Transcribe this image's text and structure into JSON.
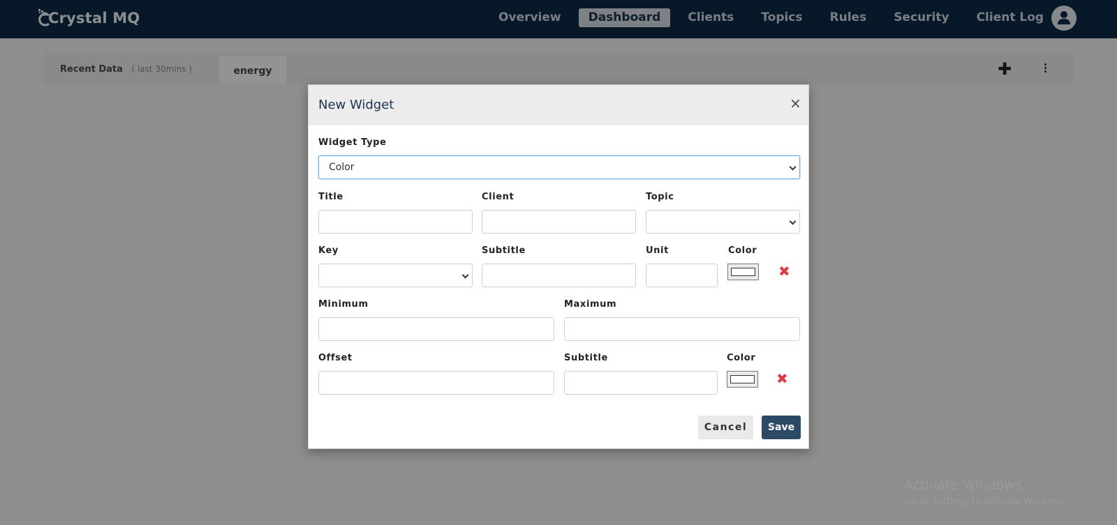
{
  "app": {
    "brand": "Crystal MQ"
  },
  "nav": {
    "items": [
      {
        "label": "Overview",
        "active": false
      },
      {
        "label": "Dashboard",
        "active": true
      },
      {
        "label": "Clients",
        "active": false
      },
      {
        "label": "Topics",
        "active": false
      },
      {
        "label": "Rules",
        "active": false
      },
      {
        "label": "Security",
        "active": false
      },
      {
        "label": "Client Log",
        "active": false
      }
    ],
    "avatar_icon": "user-icon"
  },
  "tabs": {
    "recent_label": "Recent Data",
    "recent_sub": "( last 30mins )",
    "active_tab": "energy",
    "add_icon": "plus-icon",
    "menu_icon": "kebab-menu-icon"
  },
  "modal": {
    "title": "New Widget",
    "close_icon": "close-icon",
    "widget_type": {
      "label": "Widget Type",
      "value": "Color"
    },
    "title_field": {
      "label": "Title",
      "value": ""
    },
    "client_field": {
      "label": "Client",
      "value": ""
    },
    "topic_field": {
      "label": "Topic",
      "value": ""
    },
    "key_field": {
      "label": "Key",
      "value": ""
    },
    "subtitle_field_1": {
      "label": "Subtitle",
      "value": ""
    },
    "unit_field": {
      "label": "Unit",
      "value": ""
    },
    "color_field_1": {
      "label": "Color",
      "value": "#ffffff"
    },
    "minimum_field": {
      "label": "Minimum",
      "value": ""
    },
    "maximum_field": {
      "label": "Maximum",
      "value": ""
    },
    "offset_field": {
      "label": "Offset",
      "value": ""
    },
    "subtitle_field_2": {
      "label": "Subtitle",
      "value": ""
    },
    "color_field_2": {
      "label": "Color",
      "value": "#ffffff"
    },
    "delete_icon": "x-mark-icon",
    "delete_color": "#e23a47",
    "cancel_label": "Cancel",
    "save_label": "Save"
  },
  "colors": {
    "nav_bg": "#0d2b45",
    "save_bg": "#2c4a66"
  },
  "watermark": {
    "title": "Activate Windows",
    "subtitle": "Go to Settings to activate Windows."
  }
}
